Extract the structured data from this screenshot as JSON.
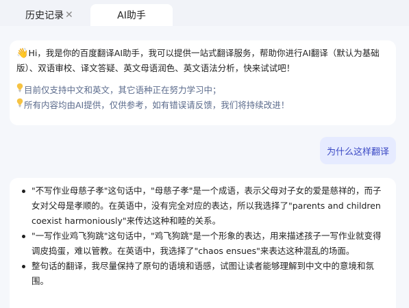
{
  "tabs": {
    "history_label": "历史记录",
    "history_close": "✕",
    "ai_label": "AI助手"
  },
  "intro": {
    "wave_emoji": "👋",
    "text": "Hi，我是你的百度翻译AI助手，我可以提供一站式翻译服务，帮助你进行AI翻译（默认为基础版）、双语审校、译文答疑、英文母语润色、英文语法分析，快来试试吧！",
    "tip_icon": "bulb-icon",
    "tip1": "目前仅支持中文和英文，其它语种正在努力学习中；",
    "tip2": "所有内容均由AI提供，仅供参考，如有错误请反馈，我们将持续改进！"
  },
  "user_message": "为什么这样翻译",
  "answer": {
    "items": [
      "\"不写作业母慈子孝\"这句话中，\"母慈子孝\"是一个成语，表示父母对子女的爱是慈祥的，而子女对父母是孝顺的。在英语中，没有完全对应的表达，所以我选择了\"parents and children coexist harmoniously\"来传达这种和睦的关系。",
      "\"一写作业鸡飞狗跳\"这句话中，\"鸡飞狗跳\"是一个形象的表达，用来描述孩子一写作业就变得调皮捣蛋，难以管教。在英语中，我选择了\"chaos ensues\"来表达这种混乱的场面。",
      "整句话的翻译，我尽量保持了原句的语境和语感，试图让读者能够理解到中文中的意境和氛围。"
    ]
  },
  "colors": {
    "tabbar_bg": "#f1f3f8",
    "content_bg": "#f5f7fb",
    "bubble_bg": "#e6ebff",
    "bubble_text": "#3a48c4",
    "tip_text": "#5b6b8c"
  }
}
